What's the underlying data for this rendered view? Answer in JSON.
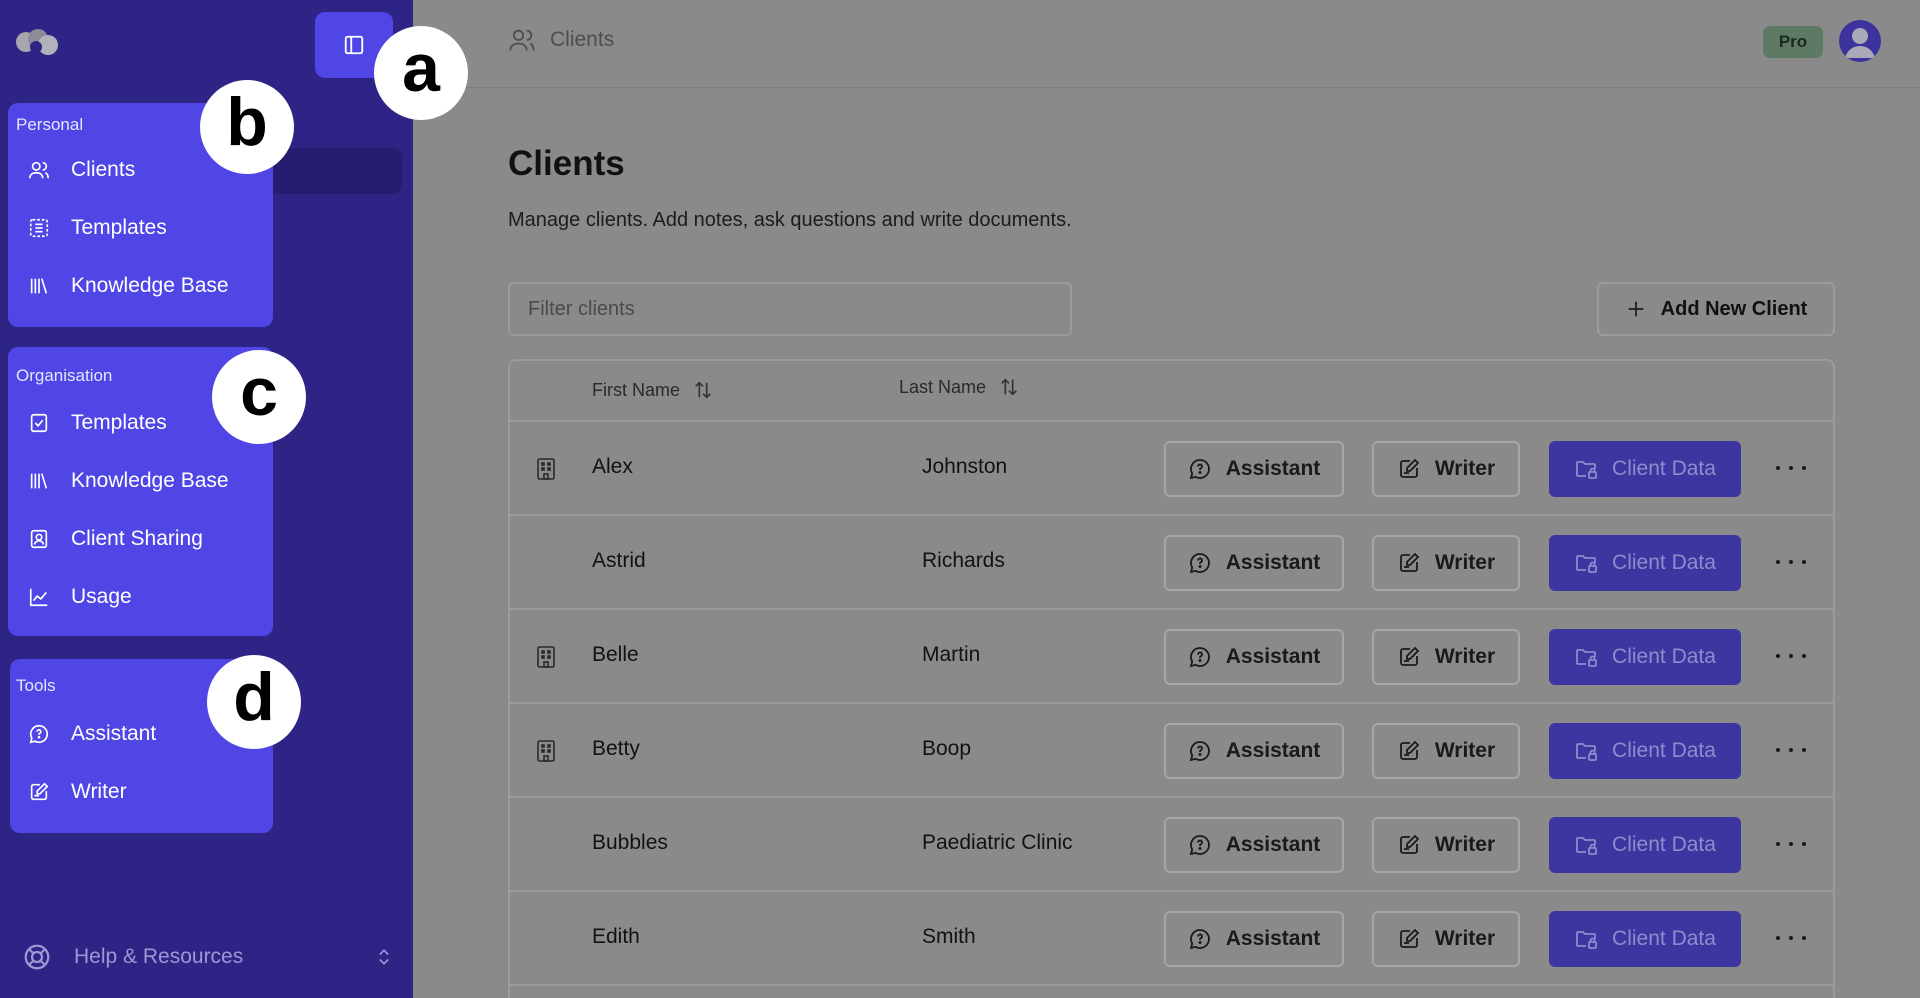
{
  "sidebar": {
    "groups": [
      {
        "title": "Personal",
        "items": [
          {
            "label": "Clients",
            "icon": "users-icon"
          },
          {
            "label": "Templates",
            "icon": "list-icon"
          },
          {
            "label": "Knowledge Base",
            "icon": "library-icon"
          }
        ]
      },
      {
        "title": "Organisation",
        "items": [
          {
            "label": "Templates",
            "icon": "clipboard-check-icon"
          },
          {
            "label": "Knowledge Base",
            "icon": "library-icon"
          },
          {
            "label": "Client Sharing",
            "icon": "contact-icon"
          },
          {
            "label": "Usage",
            "icon": "chart-line-icon"
          }
        ]
      },
      {
        "title": "Tools",
        "items": [
          {
            "label": "Assistant",
            "icon": "chat-icon"
          },
          {
            "label": "Writer",
            "icon": "edit-note-icon"
          }
        ]
      }
    ],
    "help_label": "Help & Resources"
  },
  "callouts": [
    "a",
    "b",
    "c",
    "d"
  ],
  "header": {
    "breadcrumb": "Clients",
    "badge": "Pro"
  },
  "main": {
    "title": "Clients",
    "description": "Manage clients. Add notes, ask questions and write documents.",
    "filter_placeholder": "Filter clients",
    "add_button": "Add New Client"
  },
  "table": {
    "headers": {
      "first": "First Name",
      "last": "Last Name"
    },
    "actions": {
      "assistant": "Assistant",
      "writer": "Writer",
      "client_data": "Client Data"
    },
    "rows": [
      {
        "first": "Alex",
        "last": "Johnston",
        "org": true
      },
      {
        "first": "Astrid",
        "last": "Richards",
        "org": false
      },
      {
        "first": "Belle",
        "last": "Martin",
        "org": true
      },
      {
        "first": "Betty",
        "last": "Boop",
        "org": true
      },
      {
        "first": "Bubbles",
        "last": "Paediatric Clinic",
        "org": false
      },
      {
        "first": "Edith",
        "last": "Smith",
        "org": false
      }
    ]
  },
  "colors": {
    "sidebar": "#2e2485",
    "accent": "#4f46e5",
    "overlay": "#8a8a8a",
    "pro_badge": "#5f7a64"
  }
}
